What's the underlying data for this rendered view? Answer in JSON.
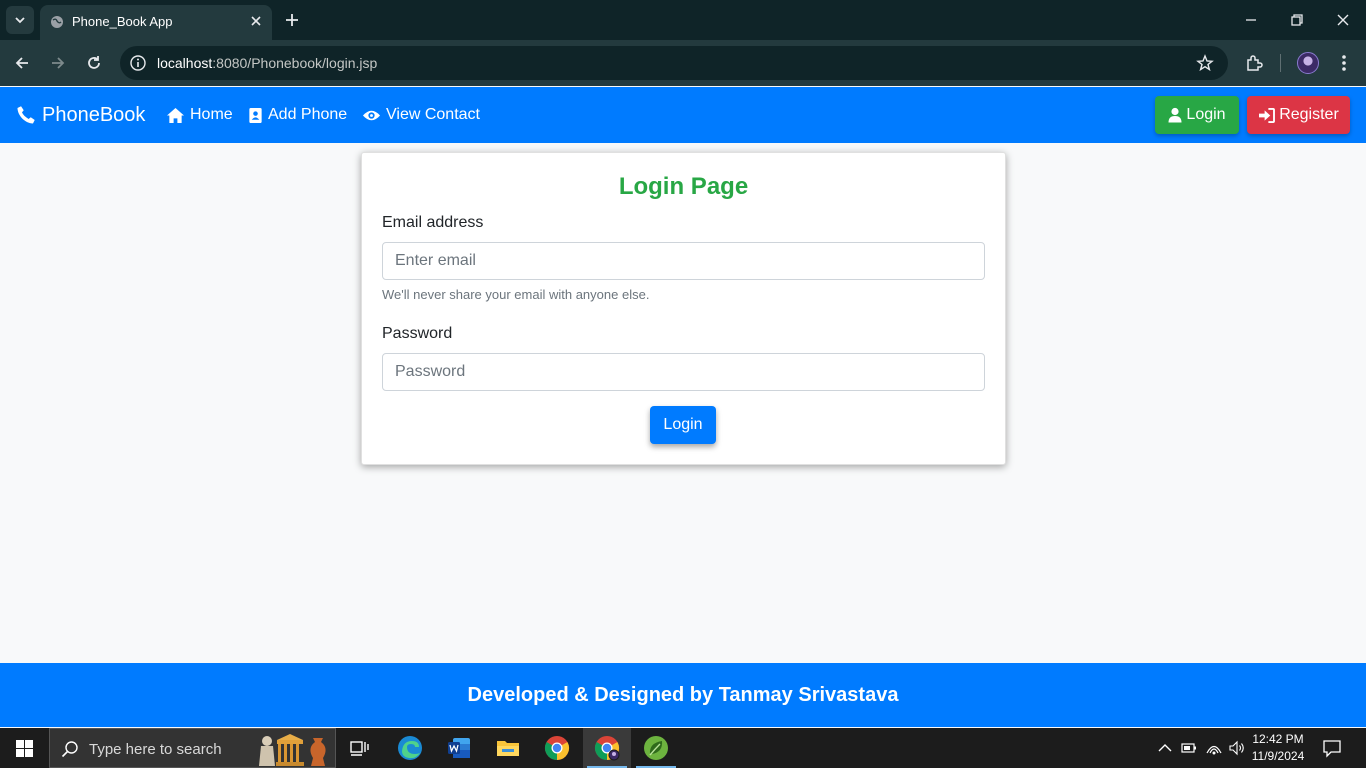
{
  "browser": {
    "tab_title": "Phone_Book App",
    "url_host": "localhost",
    "url_rest": ":8080/Phonebook/login.jsp"
  },
  "navbar": {
    "brand": "PhoneBook",
    "links": [
      "Home",
      "Add Phone",
      "View Contact"
    ],
    "login_label": "Login",
    "register_label": "Register"
  },
  "login_form": {
    "title": "Login Page",
    "email_label": "Email address",
    "email_placeholder": "Enter email",
    "email_help": "We'll never share your email with anyone else.",
    "password_label": "Password",
    "password_placeholder": "Password",
    "submit_label": "Login"
  },
  "footer": {
    "text": "Developed & Designed by Tanmay Srivastava"
  },
  "taskbar": {
    "search_placeholder": "Type here to search",
    "time": "12:42 PM",
    "date": "11/9/2024"
  },
  "colors": {
    "primary": "#007bff",
    "success": "#28a745",
    "danger": "#dc3545"
  }
}
